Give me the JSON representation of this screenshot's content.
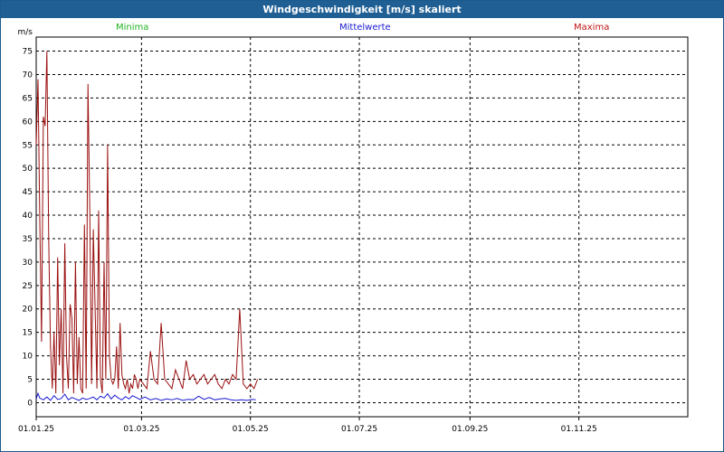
{
  "window": {
    "title": "Windgeschwindigkeit [m/s] skaliert"
  },
  "chart_data": {
    "type": "line",
    "title": "Windgeschwindigkeit [m/s] skaliert",
    "ylabel": "m/s",
    "xlabel": "",
    "ylim": [
      -3,
      78
    ],
    "xlim": [
      "2025-01-01",
      "2026-01-01"
    ],
    "grid": true,
    "legend_position": "top",
    "yticks": [
      0,
      5,
      10,
      15,
      20,
      25,
      30,
      35,
      40,
      45,
      50,
      55,
      60,
      65,
      70,
      75
    ],
    "xticks": [
      {
        "date": "2025-01-01",
        "label": "01.01.25"
      },
      {
        "date": "2025-03-01",
        "label": "01.03.25"
      },
      {
        "date": "2025-05-01",
        "label": "01.05.25"
      },
      {
        "date": "2025-07-01",
        "label": "01.07.25"
      },
      {
        "date": "2025-09-01",
        "label": "01.09.25"
      },
      {
        "date": "2025-11-01",
        "label": "01.11.25"
      }
    ],
    "series": [
      {
        "name": "Minima",
        "color": "#22b322",
        "x": [],
        "y": []
      },
      {
        "name": "Mittelwerte",
        "color": "#1a1ad0",
        "x": [
          "2025-01-01",
          "2025-01-02",
          "2025-01-03",
          "2025-01-05",
          "2025-01-07",
          "2025-01-09",
          "2025-01-11",
          "2025-01-13",
          "2025-01-15",
          "2025-01-17",
          "2025-01-19",
          "2025-01-21",
          "2025-01-23",
          "2025-01-25",
          "2025-01-27",
          "2025-01-29",
          "2025-01-31",
          "2025-02-02",
          "2025-02-04",
          "2025-02-06",
          "2025-02-08",
          "2025-02-10",
          "2025-02-12",
          "2025-02-14",
          "2025-02-16",
          "2025-02-18",
          "2025-02-20",
          "2025-02-22",
          "2025-02-24",
          "2025-02-26",
          "2025-02-28",
          "2025-03-03",
          "2025-03-06",
          "2025-03-09",
          "2025-03-12",
          "2025-03-15",
          "2025-03-18",
          "2025-03-21",
          "2025-03-24",
          "2025-03-27",
          "2025-03-30",
          "2025-04-02",
          "2025-04-05",
          "2025-04-08",
          "2025-04-11",
          "2025-04-14",
          "2025-04-17",
          "2025-04-20",
          "2025-04-23",
          "2025-04-26",
          "2025-04-29",
          "2025-05-02",
          "2025-05-04"
        ],
        "y": [
          0.8,
          2.0,
          1.0,
          0.6,
          1.2,
          0.5,
          1.5,
          0.7,
          0.9,
          1.8,
          0.6,
          1.1,
          0.8,
          0.5,
          1.0,
          0.7,
          0.9,
          1.2,
          0.6,
          1.4,
          1.0,
          1.9,
          0.8,
          1.6,
          1.0,
          0.6,
          1.3,
          0.8,
          1.5,
          1.1,
          0.7,
          1.2,
          0.6,
          0.9,
          0.5,
          0.8,
          0.6,
          0.9,
          0.5,
          0.7,
          0.6,
          1.4,
          0.7,
          1.1,
          0.6,
          0.8,
          0.9,
          0.6,
          0.5,
          0.6,
          0.5,
          0.7,
          0.6
        ]
      },
      {
        "name": "Maxima",
        "color": "#9b1010",
        "x": [
          "2025-01-01",
          "2025-01-02",
          "2025-01-03",
          "2025-01-04",
          "2025-01-05",
          "2025-01-06",
          "2025-01-07",
          "2025-01-08",
          "2025-01-09",
          "2025-01-10",
          "2025-01-11",
          "2025-01-12",
          "2025-01-13",
          "2025-01-14",
          "2025-01-15",
          "2025-01-16",
          "2025-01-17",
          "2025-01-18",
          "2025-01-19",
          "2025-01-20",
          "2025-01-21",
          "2025-01-22",
          "2025-01-23",
          "2025-01-24",
          "2025-01-25",
          "2025-01-26",
          "2025-01-27",
          "2025-01-28",
          "2025-01-29",
          "2025-01-30",
          "2025-01-31",
          "2025-02-01",
          "2025-02-02",
          "2025-02-03",
          "2025-02-04",
          "2025-02-05",
          "2025-02-06",
          "2025-02-07",
          "2025-02-08",
          "2025-02-09",
          "2025-02-10",
          "2025-02-11",
          "2025-02-12",
          "2025-02-13",
          "2025-02-14",
          "2025-02-15",
          "2025-02-16",
          "2025-02-17",
          "2025-02-18",
          "2025-02-19",
          "2025-02-20",
          "2025-02-21",
          "2025-02-22",
          "2025-02-23",
          "2025-02-24",
          "2025-02-25",
          "2025-02-26",
          "2025-02-27",
          "2025-02-28",
          "2025-03-02",
          "2025-03-04",
          "2025-03-06",
          "2025-03-08",
          "2025-03-10",
          "2025-03-12",
          "2025-03-14",
          "2025-03-16",
          "2025-03-18",
          "2025-03-20",
          "2025-03-22",
          "2025-03-24",
          "2025-03-26",
          "2025-03-28",
          "2025-03-30",
          "2025-04-01",
          "2025-04-03",
          "2025-04-05",
          "2025-04-07",
          "2025-04-09",
          "2025-04-11",
          "2025-04-13",
          "2025-04-15",
          "2025-04-17",
          "2025-04-19",
          "2025-04-21",
          "2025-04-23",
          "2025-04-25",
          "2025-04-27",
          "2025-04-29",
          "2025-05-01",
          "2025-05-03",
          "2025-05-05"
        ],
        "y": [
          55,
          69,
          40,
          13,
          61,
          59,
          75,
          35,
          12,
          3,
          15,
          2,
          31,
          8,
          20,
          2,
          34,
          10,
          3,
          21,
          18,
          2,
          30,
          4,
          14,
          3,
          2,
          38,
          3,
          68,
          41,
          4,
          37,
          20,
          3,
          41,
          5,
          2,
          30,
          5,
          55,
          10,
          5,
          4,
          5,
          12,
          3,
          17,
          6,
          4,
          3,
          5,
          2,
          4,
          3,
          6,
          5,
          3,
          5,
          4,
          3,
          11,
          5,
          4,
          17,
          5,
          4,
          3,
          7,
          5,
          3,
          9,
          5,
          6,
          4,
          5,
          6,
          4,
          5,
          6,
          4,
          3,
          5,
          4,
          6,
          5,
          20,
          4,
          3,
          4,
          3,
          5
        ]
      }
    ]
  }
}
